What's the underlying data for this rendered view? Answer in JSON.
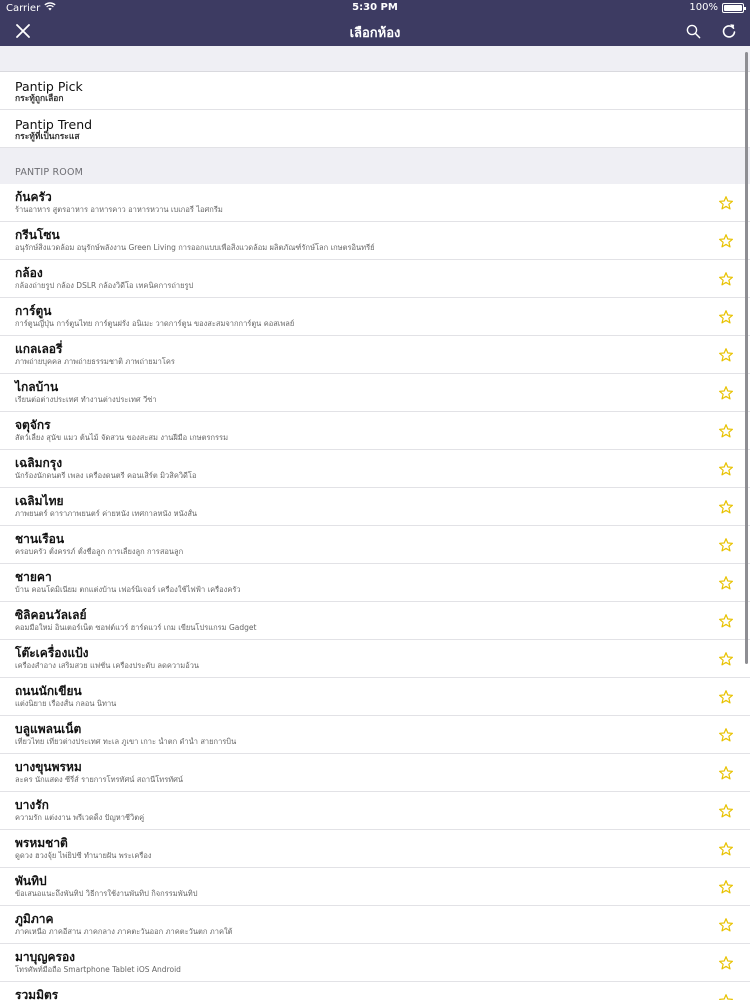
{
  "status_bar": {
    "carrier": "Carrier",
    "time": "5:30 PM",
    "battery": "100%"
  },
  "nav": {
    "title": "เลือกห้อง"
  },
  "picks": [
    {
      "title": "Pantip Pick",
      "subtitle": "กระทู้ถูกเลือก"
    },
    {
      "title": "Pantip Trend",
      "subtitle": "กระทู้ที่เป็นกระแส"
    }
  ],
  "section_header": "PANTIP ROOM",
  "rooms": [
    {
      "name": "ก้นครัว",
      "desc": "ร้านอาหาร สูตรอาหาร อาหารคาว อาหารหวาน เบเกอรี่ ไอศกรีม"
    },
    {
      "name": "กรีนโซน",
      "desc": "อนุรักษ์สิ่งแวดล้อม อนุรักษ์พลังงาน Green Living การออกแบบเพื่อสิ่งแวดล้อม ผลิตภัณฑ์รักษ์โลก เกษตรอินทรีย์"
    },
    {
      "name": "กล้อง",
      "desc": "กล้องถ่ายรูป กล้อง DSLR กล้องวิดีโอ เทคนิคการถ่ายรูป"
    },
    {
      "name": "การ์ตูน",
      "desc": "การ์ตูนญี่ปุ่น การ์ตูนไทย การ์ตูนฝรั่ง อนิเมะ วาดการ์ตูน ของสะสมจากการ์ตูน คอสเพลย์"
    },
    {
      "name": "แกลเลอรี่",
      "desc": "ภาพถ่ายบุคคล ภาพถ่ายธรรมชาติ ภาพถ่ายมาโคร"
    },
    {
      "name": "ไกลบ้าน",
      "desc": "เรียนต่อต่างประเทศ ทำงานต่างประเทศ วีซ่า"
    },
    {
      "name": "จตุจักร",
      "desc": "สัตว์เลี้ยง สุนัข แมว ต้นไม้ จัดสวน ของสะสม งานฝีมือ เกษตรกรรม"
    },
    {
      "name": "เฉลิมกรุง",
      "desc": "นักร้องนักดนตรี เพลง เครื่องดนตรี คอนเสิร์ต มิวสิควิดีโอ"
    },
    {
      "name": "เฉลิมไทย",
      "desc": "ภาพยนตร์ ดาราภาพยนตร์ ค่ายหนัง เทศกาลหนัง หนังสั้น"
    },
    {
      "name": "ชานเรือน",
      "desc": "ครอบครัว ตั้งครรภ์ ตั้งชื่อลูก การเลี้ยงลูก การสอนลูก"
    },
    {
      "name": "ชายคา",
      "desc": "บ้าน คอนโดมิเนียม ตกแต่งบ้าน เฟอร์นิเจอร์ เครื่องใช้ไฟฟ้า เครื่องครัว"
    },
    {
      "name": "ซิลิคอนวัลเลย์",
      "desc": "คอมมือใหม่ อินเตอร์เน็ต ซอฟต์แวร์ ฮาร์ดแวร์ เกม เขียนโปรแกรม Gadget"
    },
    {
      "name": "โต๊ะเครื่องแป้ง",
      "desc": "เครื่องสำอาง เสริมสวย แฟชั่น เครื่องประดับ ลดความอ้วน"
    },
    {
      "name": "ถนนนักเขียน",
      "desc": "แต่งนิยาย เรื่องสั้น กลอน นิทาน"
    },
    {
      "name": "บลูแพลนเน็ต",
      "desc": "เที่ยวไทย เที่ยวต่างประเทศ ทะเล ภูเขา เกาะ น้ำตก ดำน้ำ สายการบิน"
    },
    {
      "name": "บางขุนพรหม",
      "desc": "ละคร นักแสดง ซีรี่ส์ รายการโทรทัศน์ สถานีโทรทัศน์"
    },
    {
      "name": "บางรัก",
      "desc": "ความรัก แต่งงาน พรีเวดดิ้ง ปัญหาชีวิตคู่"
    },
    {
      "name": "พรหมชาติ",
      "desc": "ดูดวง ฮวงจุ้ย ไพ่ยิปซี ทำนายฝัน พระเครื่อง"
    },
    {
      "name": "พันทิป",
      "desc": "ข้อเสนอแนะถึงพันทิป วิธีการใช้งานพันทิป กิจกรรมพันทิป"
    },
    {
      "name": "ภูมิภาค",
      "desc": "ภาคเหนือ ภาคอีสาน ภาคกลาง ภาคตะวันออก ภาคตะวันตก ภาคใต้"
    },
    {
      "name": "มาบุญครอง",
      "desc": "โทรศัพท์มือถือ Smartphone Tablet iOS Android"
    },
    {
      "name": "รวมมิตร",
      "desc": ""
    }
  ],
  "colors": {
    "nav_bg": "#3d3b62",
    "star": "#e8c200"
  }
}
